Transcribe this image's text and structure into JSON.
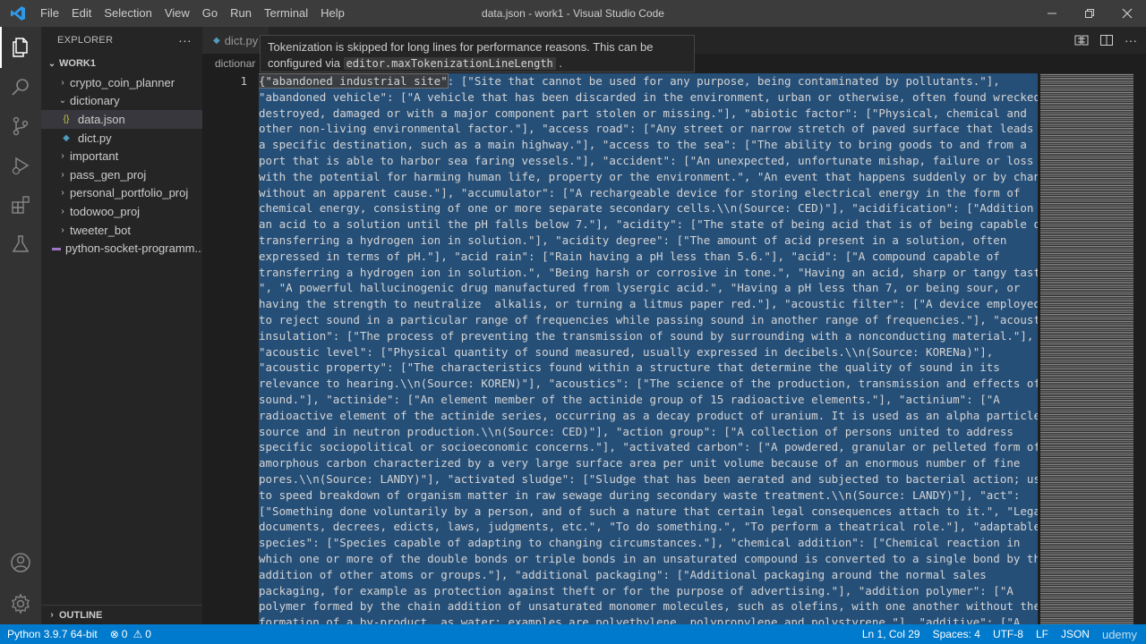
{
  "window_title": "data.json - work1 - Visual Studio Code",
  "menu": [
    "File",
    "Edit",
    "Selection",
    "View",
    "Go",
    "Run",
    "Terminal",
    "Help"
  ],
  "sidebar": {
    "header": "EXPLORER",
    "more": "···",
    "root": "WORK1",
    "items": [
      {
        "label": "crypto_coin_planner"
      },
      {
        "label": "dictionary"
      },
      {
        "label": "data.json"
      },
      {
        "label": "dict.py"
      },
      {
        "label": "important"
      },
      {
        "label": "pass_gen_proj"
      },
      {
        "label": "personal_portfolio_proj"
      },
      {
        "label": "todowoo_proj"
      },
      {
        "label": "tweeter_bot"
      },
      {
        "label": "python-socket-programm..."
      }
    ],
    "outline": "OUTLINE"
  },
  "tabs": [
    {
      "label": "dict.py"
    }
  ],
  "breadcrumb": "dictionar",
  "hover": {
    "text_1": "Tokenization is skipped for long lines for performance reasons. This can be",
    "text_2": "configured via",
    "setting": "editor.maxTokenizationLineLength",
    "text_3": "."
  },
  "editor": {
    "line_number": "1",
    "selected_word": "{\"abandoned industrial site\"",
    "lines": [
      ": [\"Site that cannot be used for any purpose, being contaminated by pollutants.\"],",
      "\"abandoned vehicle\": [\"A vehicle that has been discarded in the environment, urban or otherwise, often found wrecked,",
      "destroyed, damaged or with a major component part stolen or missing.\"], \"abiotic factor\": [\"Physical, chemical and",
      "other non-living environmental factor.\"], \"access road\": [\"Any street or narrow stretch of paved surface that leads to",
      "a specific destination, such as a main highway.\"], \"access to the sea\": [\"The ability to bring goods to and from a",
      "port that is able to harbor sea faring vessels.\"], \"accident\": [\"An unexpected, unfortunate mishap, failure or loss",
      "with the potential for harming human life, property or the environment.\", \"An event that happens suddenly or by chance",
      "without an apparent cause.\"], \"accumulator\": [\"A rechargeable device for storing electrical energy in the form of",
      "chemical energy, consisting of one or more separate secondary cells.\\\\n(Source: CED)\"], \"acidification\": [\"Addition of",
      "an acid to a solution until the pH falls below 7.\"], \"acidity\": [\"The state of being acid that is of being capable of",
      "transferring a hydrogen ion in solution.\"], \"acidity degree\": [\"The amount of acid present in a solution, often",
      "expressed in terms of pH.\"], \"acid rain\": [\"Rain having a pH less than 5.6.\"], \"acid\": [\"A compound capable of",
      "transferring a hydrogen ion in solution.\", \"Being harsh or corrosive in tone.\", \"Having an acid, sharp or tangy taste.",
      "\", \"A powerful hallucinogenic drug manufactured from lysergic acid.\", \"Having a pH less than 7, or being sour, or",
      "having the strength to neutralize  alkalis, or turning a litmus paper red.\"], \"acoustic filter\": [\"A device employed",
      "to reject sound in a particular range of frequencies while passing sound in another range of frequencies.\"], \"acoustic",
      "insulation\": [\"The process of preventing the transmission of sound by surrounding with a nonconducting material.\"],",
      "\"acoustic level\": [\"Physical quantity of sound measured, usually expressed in decibels.\\\\n(Source: KORENa)\"],",
      "\"acoustic property\": [\"The characteristics found within a structure that determine the quality of sound in its",
      "relevance to hearing.\\\\n(Source: KOREN)\"], \"acoustics\": [\"The science of the production, transmission and effects of",
      "sound.\"], \"actinide\": [\"An element member of the actinide group of 15 radioactive elements.\"], \"actinium\": [\"A",
      "radioactive element of the actinide series, occurring as a decay product of uranium. It is used as an alpha particle",
      "source and in neutron production.\\\\n(Source: CED)\"], \"action group\": [\"A collection of persons united to address",
      "specific sociopolitical or socioeconomic concerns.\"], \"activated carbon\": [\"A powdered, granular or pelleted form of",
      "amorphous carbon characterized by a very large surface area per unit volume because of an enormous number of fine",
      "pores.\\\\n(Source: LANDY)\"], \"activated sludge\": [\"Sludge that has been aerated and subjected to bacterial action; used",
      "to speed breakdown of organism matter in raw sewage during secondary waste treatment.\\\\n(Source: LANDY)\"], \"act\":",
      "[\"Something done voluntarily by a person, and of such a nature that certain legal consequences attach to it.\", \"Legal",
      "documents, decrees, edicts, laws, judgments, etc.\", \"To do something.\", \"To perform a theatrical role.\"], \"adaptable",
      "species\": [\"Species capable of adapting to changing circumstances.\"], \"chemical addition\": [\"Chemical reaction in",
      "which one or more of the double bonds or triple bonds in an unsaturated compound is converted to a single bond by the",
      "addition of other atoms or groups.\"], \"additional packaging\": [\"Additional packaging around the normal sales",
      "packaging, for example as protection against theft or for the purpose of advertising.\"], \"addition polymer\": [\"A",
      "polymer formed by the chain addition of unsaturated monomer molecules, such as olefins, with one another without the",
      "formation of a by-product, as water; examples are polyethylene, polypropylene and polystyrene.\"], \"additive\": [\"A"
    ]
  },
  "status": {
    "python": "Python 3.9.7 64-bit",
    "errors": "0",
    "warnings": "0",
    "position": "Ln 1, Col 29",
    "spaces": "Spaces: 4",
    "encoding": "UTF-8",
    "eol": "LF",
    "language": "JSON",
    "watermark": "udemy"
  },
  "colors": {
    "status_bar": "#007acc",
    "selection": "#264f78",
    "activity_bar": "#333333",
    "sidebar": "#252526",
    "editor": "#1e1e1e"
  }
}
